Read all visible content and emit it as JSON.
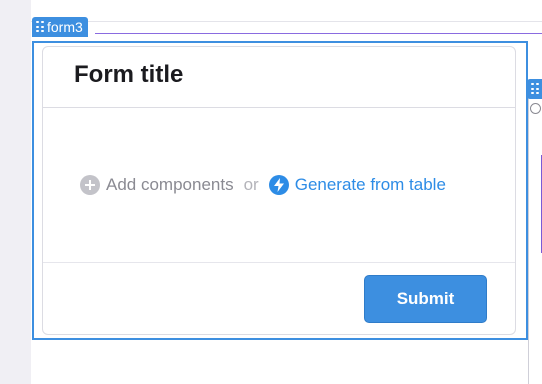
{
  "component_tag": {
    "label": "form3"
  },
  "form": {
    "title": "Form title",
    "empty_state": {
      "add_label": "Add components",
      "or_label": "or",
      "generate_label": "Generate from table"
    },
    "submit_label": "Submit"
  },
  "colors": {
    "selection": "#3d8fe0",
    "link": "#2d8ce6",
    "button": "#3d8fe0",
    "muted": "#8a8a92"
  },
  "icons": [
    "drag-handle-icon",
    "plus-circle-icon",
    "lightning-icon"
  ]
}
